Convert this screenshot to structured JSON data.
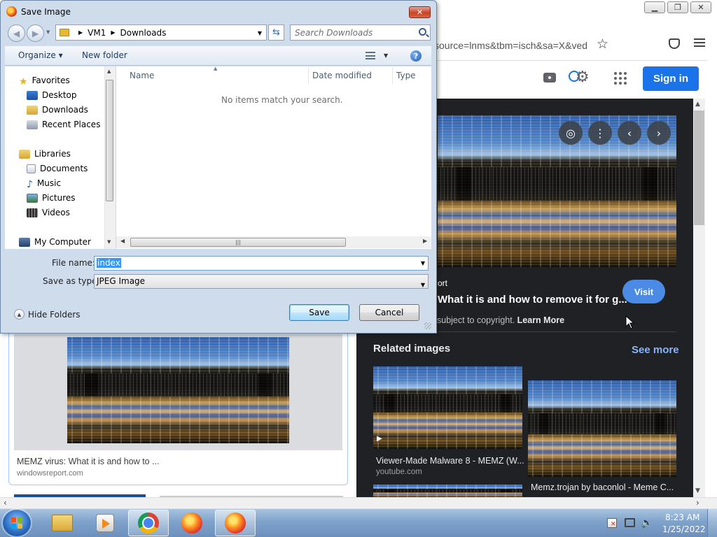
{
  "browser": {
    "url_fragment": "source=lnms&tbm=isch&sa=X&ved",
    "minimize_glyph": "▁",
    "maximize_glyph": "❐",
    "close_glyph": "✕",
    "icons": [
      "star-icon",
      "pocket-icon",
      "menu-icon",
      "camera-icon",
      "search-icon",
      "gear-icon",
      "apps-icon"
    ]
  },
  "google": {
    "signin_label": "Sign in"
  },
  "preview": {
    "source_partial": "ort",
    "title_partial": "What it is and how to remove it for g...",
    "visit_label": "Visit",
    "copyright_text": "subject to copyright.",
    "learn_more_label": "Learn More",
    "related_title": "Related images",
    "see_more_label": "See more",
    "related": [
      {
        "caption": "Viewer-Made Malware 8 - MEMZ (W...",
        "source": "youtube.com"
      },
      {
        "caption": "Memz.trojan by baconlol - Meme C..."
      }
    ]
  },
  "left_result": {
    "title": "MEMZ virus: What it is and how to ...",
    "source": "windowsreport.com"
  },
  "dialog": {
    "title": "Save Image",
    "close_glyph": "✕",
    "breadcrumb": [
      "VM1",
      "Downloads"
    ],
    "search_placeholder": "Search Downloads",
    "organize_label": "Organize ▾",
    "new_folder_label": "New folder",
    "help_glyph": "?",
    "nav": {
      "favorites": "Favorites",
      "desktop": "Desktop",
      "downloads": "Downloads",
      "recent": "Recent Places",
      "libraries": "Libraries",
      "documents": "Documents",
      "music": "Music",
      "pictures": "Pictures",
      "videos": "Videos",
      "computer": "My Computer"
    },
    "columns": [
      "Name",
      "Date modified",
      "Type"
    ],
    "empty_message": "No items match your search.",
    "file_name_label": "File name:",
    "file_name_value": "index",
    "save_type_label": "Save as type:",
    "save_type_value": "JPEG Image",
    "hide_folders_label": "Hide Folders",
    "save_label": "Save",
    "cancel_label": "Cancel"
  },
  "taskbar": {
    "time": "8:23 AM",
    "date": "1/25/2022"
  },
  "colors": {
    "accent": "#1a73e8",
    "dark_panel": "#202124",
    "dialog_frame": "#cfdcec",
    "taskbar": "#7fa2cb"
  }
}
